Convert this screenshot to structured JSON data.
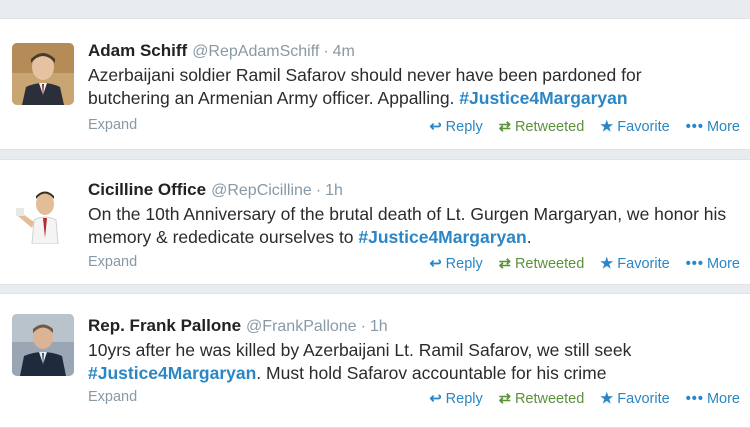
{
  "tweets": [
    {
      "name": "Adam Schiff",
      "handle": "@RepAdamSchiff",
      "separator": "·",
      "time": "4m",
      "text_before": "Azerbaijani soldier Ramil Safarov should never have been pardoned for butchering an Armenian Army officer. Appalling. ",
      "hashtag": "#Justice4Margaryan",
      "text_after": "",
      "expand": "Expand",
      "actions": {
        "reply": "Reply",
        "retweet": "Retweeted",
        "favorite": "Favorite",
        "more": "More"
      }
    },
    {
      "name": "Cicilline Office",
      "handle": "@RepCicilline",
      "separator": "·",
      "time": "1h",
      "text_before": "On the 10th Anniversary of the brutal death of Lt. Gurgen Margaryan, we honor his memory & rededicate ourselves to ",
      "hashtag": "#Justice4Margaryan",
      "text_after": ".",
      "expand": "Expand",
      "actions": {
        "reply": "Reply",
        "retweet": "Retweeted",
        "favorite": "Favorite",
        "more": "More"
      }
    },
    {
      "name": "Rep. Frank Pallone",
      "handle": "@FrankPallone",
      "separator": "·",
      "time": "1h",
      "text_before": "10yrs after he was killed by Azerbaijani Lt. Ramil Safarov, we still seek ",
      "hashtag": "#Justice4Margaryan",
      "text_after": ". Must hold Safarov accountable for his crime",
      "expand": "Expand",
      "actions": {
        "reply": "Reply",
        "retweet": "Retweeted",
        "favorite": "Favorite",
        "more": "More"
      }
    }
  ],
  "icons": {
    "reply": "reply-arrow-icon",
    "retweet": "retweet-icon",
    "favorite": "star-icon",
    "more": "more-dots-icon"
  },
  "colors": {
    "link": "#2a86c5",
    "retweeted": "#5c913b",
    "muted": "#8899a6",
    "background": "#e9ecee"
  }
}
